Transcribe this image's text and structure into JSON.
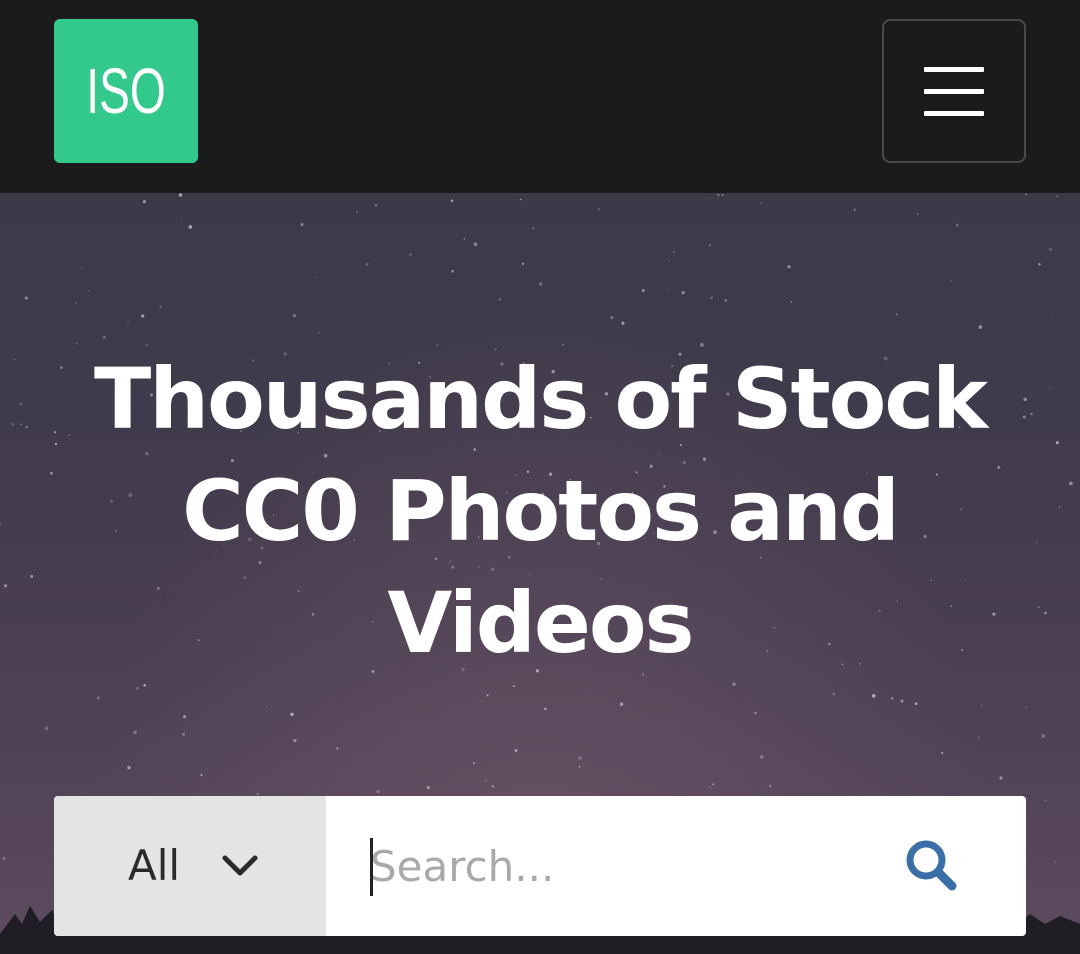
{
  "header": {
    "logo_text": "ISO",
    "menu_icon": "hamburger-menu-icon",
    "brand_color": "#33c98d"
  },
  "hero": {
    "title": "Thousands of Stock CC0 Photos and Videos"
  },
  "search": {
    "category_selected": "All",
    "placeholder": "Search...",
    "value": "",
    "search_icon": "search-icon",
    "icon_color": "#3a6fa8"
  }
}
